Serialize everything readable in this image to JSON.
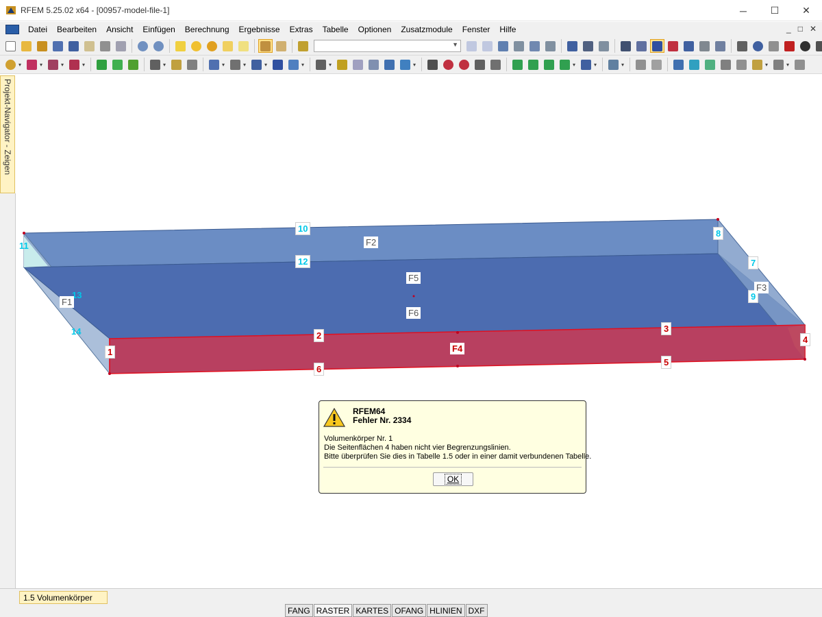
{
  "window": {
    "title": "RFEM 5.25.02 x64 - [00957-model-file-1]",
    "minimize": "─",
    "maximize": "☐",
    "close": "✕"
  },
  "menubar": {
    "items": [
      "Datei",
      "Bearbeiten",
      "Ansicht",
      "Einfügen",
      "Berechnung",
      "Ergebnisse",
      "Extras",
      "Tabelle",
      "Optionen",
      "Zusatzmodule",
      "Fenster",
      "Hilfe"
    ],
    "mdi_min": "_",
    "mdi_restore": "□",
    "mdi_close": "✕"
  },
  "toolbar1": {
    "combo_value": ""
  },
  "navigator": {
    "label": "Projekt-Navigator - Zeigen"
  },
  "model": {
    "cyan_labels": [
      "10",
      "11",
      "8",
      "12",
      "7",
      "13",
      "9",
      "14"
    ],
    "red_labels": [
      "2",
      "3",
      "1",
      "4",
      "6",
      "5"
    ],
    "surface_labels": [
      "F2",
      "F5",
      "F3",
      "F1",
      "F6",
      "F4"
    ],
    "colors": {
      "top_face": "#4c6cb0",
      "back_face": "#6b8dc4",
      "side_face": "#9cb4d4",
      "front_face": "#b84060",
      "front_edge": "#e01020",
      "cyan_label": "#00c8e8",
      "red_label": "#c80000"
    }
  },
  "dialog": {
    "app": "RFEM64",
    "error": "Fehler Nr. 2334",
    "line1": "Volumenkörper Nr. 1",
    "line2": "Die Seitenflächen 4 haben nicht vier Begrenzungslinien.",
    "line3": "Bitte überprüfen Sie dies in Tabelle 1.5 oder in einer damit verbundenen Tabelle.",
    "ok": "OK"
  },
  "table_tab": {
    "label": "1.5 Volumenkörper"
  },
  "status_bar": {
    "buttons": [
      "FANG",
      "RASTER",
      "KARTES",
      "OFANG",
      "HLINIEN",
      "DXF"
    ]
  }
}
